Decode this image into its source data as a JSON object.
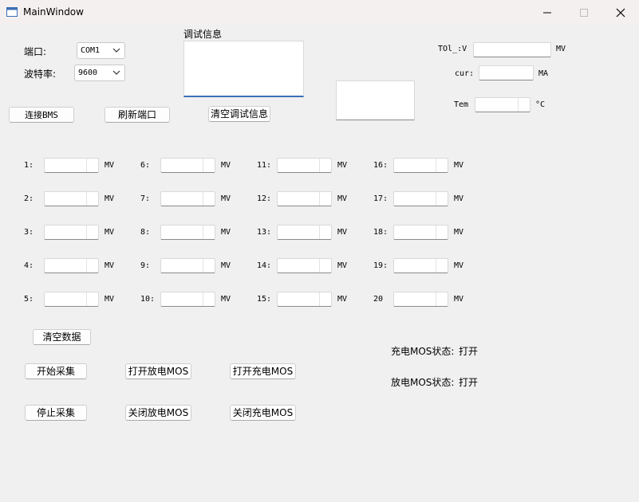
{
  "window": {
    "title": "MainWindow"
  },
  "serial": {
    "port_label": "端口:",
    "port_value": "COM1",
    "baud_label": "波特率:",
    "baud_value": "9600"
  },
  "debug": {
    "label": "调试信息"
  },
  "buttons": {
    "connect_bms": "连接BMS",
    "refresh_port": "刷新端口",
    "clear_debug": "清空调试信息",
    "clear_data": "清空数据",
    "start_collect": "开始采集",
    "stop_collect": "停止采集",
    "open_discharge_mos": "打开放电MOS",
    "close_discharge_mos": "关闭放电MOS",
    "open_charge_mos": "打开充电MOS",
    "close_charge_mos": "关闭充电MOS"
  },
  "readouts": {
    "total_voltage_label": "TOl_:V",
    "total_voltage_unit": "MV",
    "current_label": "cur:",
    "current_unit": "MA",
    "temp_label": "Tem",
    "temp_unit": "°C"
  },
  "cells": {
    "unit": "MV",
    "col1": [
      "1:",
      "2:",
      "3:",
      "4:",
      "5:"
    ],
    "col2": [
      "6:",
      "7:",
      "8:",
      "9:",
      "10:"
    ],
    "col3": [
      "11:",
      "12:",
      "13:",
      "14:",
      "15:"
    ],
    "col4": [
      "16:",
      "17:",
      "18:",
      "19:",
      "20"
    ]
  },
  "status": {
    "charge_mos_label": "充电MOS状态:",
    "charge_mos_value": "打开",
    "discharge_mos_label": "放电MOS状态:",
    "discharge_mos_value": "打开"
  }
}
